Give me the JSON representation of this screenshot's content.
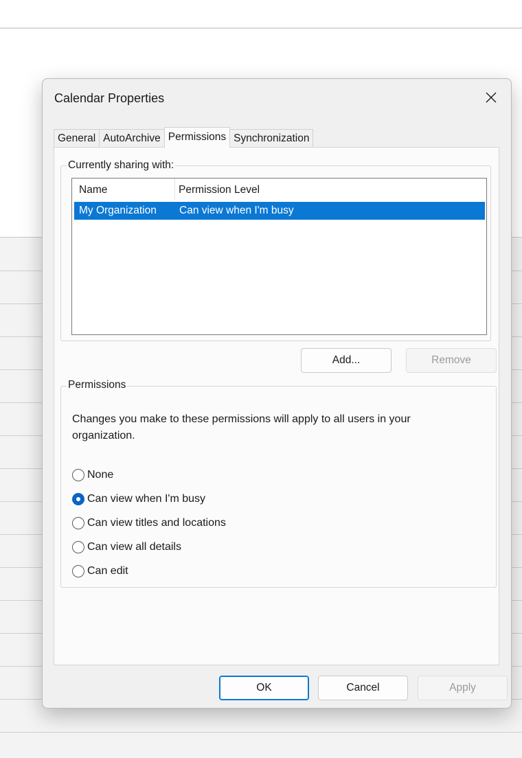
{
  "dialog": {
    "title": "Calendar Properties",
    "close_icon": "close-icon"
  },
  "tabs": [
    {
      "label": "General",
      "active": false
    },
    {
      "label": "AutoArchive",
      "active": false
    },
    {
      "label": "Permissions",
      "active": true
    },
    {
      "label": "Synchronization",
      "active": false
    }
  ],
  "sharing": {
    "legend": "Currently sharing with:",
    "columns": [
      "Name",
      "Permission Level"
    ],
    "rows": [
      {
        "name": "My Organization",
        "level": "Can view when I'm busy",
        "selected": true
      }
    ],
    "add_label": "Add...",
    "remove_label": "Remove"
  },
  "permissions": {
    "legend": "Permissions",
    "note": "Changes you make to these permissions will apply to all users in your organization.",
    "options": [
      {
        "label": "None",
        "checked": false
      },
      {
        "label": "Can view when I'm busy",
        "checked": true
      },
      {
        "label": "Can view titles and locations",
        "checked": false
      },
      {
        "label": "Can view all details",
        "checked": false
      },
      {
        "label": "Can edit",
        "checked": false
      }
    ]
  },
  "footer": {
    "ok_label": "OK",
    "cancel_label": "Cancel",
    "apply_label": "Apply"
  },
  "colors": {
    "accent": "#0b78d4",
    "dialog_bg": "#f0f0f0"
  }
}
